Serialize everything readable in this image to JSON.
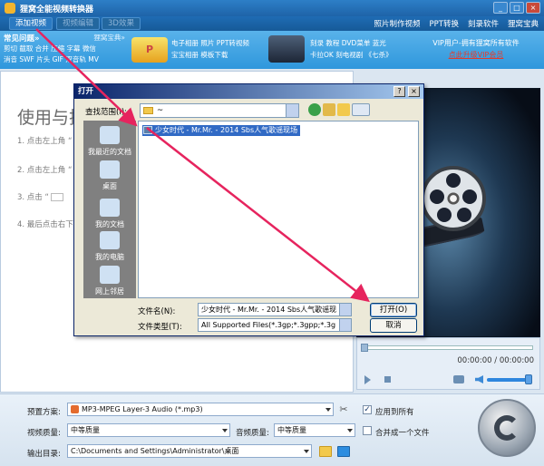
{
  "app": {
    "title": "狸窝全能视频转换器",
    "window_buttons": [
      "_",
      "□",
      "×"
    ]
  },
  "toolbar": {
    "add_video": "添加视频",
    "edit_video": "视频编辑",
    "effects": "3D效果",
    "right_links": [
      "照片制作视频",
      "PPT转换",
      "刻录软件",
      "狸窝宝典"
    ]
  },
  "promo": {
    "faq_title": "常见问题»",
    "faq_more": "狸窝宝典»",
    "faq_lines": [
      "剪切 截取 合并 压缩 字幕 微信",
      "消音 SWF 片头 GIF 双音轨 MV"
    ],
    "ad1_icon_text": "P",
    "ad1_lines": [
      "电子相册 照片 PPT转视频",
      "宝宝相册 模板下载"
    ],
    "ad2_lines": [
      "刻录 教程 DVD菜单 蓝光",
      "卡拉OK 刻电视剧 《七杀》"
    ],
    "vip_line": "VIP用户-拥有狸窝所有软件",
    "vip_upgrade": "点此升级VIP会员"
  },
  "guide": {
    "title": "使用与技巧",
    "steps": [
      "1. 点击左上角 “",
      "2. 点击左上角 “",
      "3. 点击 “",
      "4. 最后点击右下"
    ]
  },
  "player": {
    "time": "00:00:00 / 00:00:00",
    "volume_fraction": 0.9
  },
  "settings": {
    "preset_label": "预置方案:",
    "preset_value": "MP3-MPEG Layer-3 Audio (*.mp3)",
    "apply_all_label": "应用到所有",
    "apply_all_checked": "✓",
    "video_quality_label": "视频质量:",
    "video_quality_value": "中等质量",
    "audio_quality_label": "音频质量:",
    "audio_quality_value": "中等质量",
    "merge_label": "合并成一个文件",
    "output_label": "输出目录:",
    "output_value": "C:\\Documents and Settings\\Administrator\\桌面"
  },
  "dialog": {
    "title": "打开",
    "help": "?",
    "close": "×",
    "lookin_label": "查找范围(I):",
    "lookin_value": "~",
    "places": [
      "我最近的文档",
      "桌面",
      "我的文档",
      "我的电脑",
      "网上邻居"
    ],
    "file_item": "少女时代 - Mr.Mr. - 2014 Sbs人气歌谣现场",
    "filename_label": "文件名(N):",
    "filename_value": "少女时代 - Mr.Mr. - 2014 Sbs人气歌谣现",
    "filetype_label": "文件类型(T):",
    "filetype_value": "All Supported Files(*.3gp;*.3gpp;*.3g",
    "open_button": "打开(O)",
    "cancel_button": "取消"
  },
  "colors": {
    "accent": "#1e63a8",
    "annotation_arrow": "#e6245e",
    "selection": "#316ac5"
  }
}
